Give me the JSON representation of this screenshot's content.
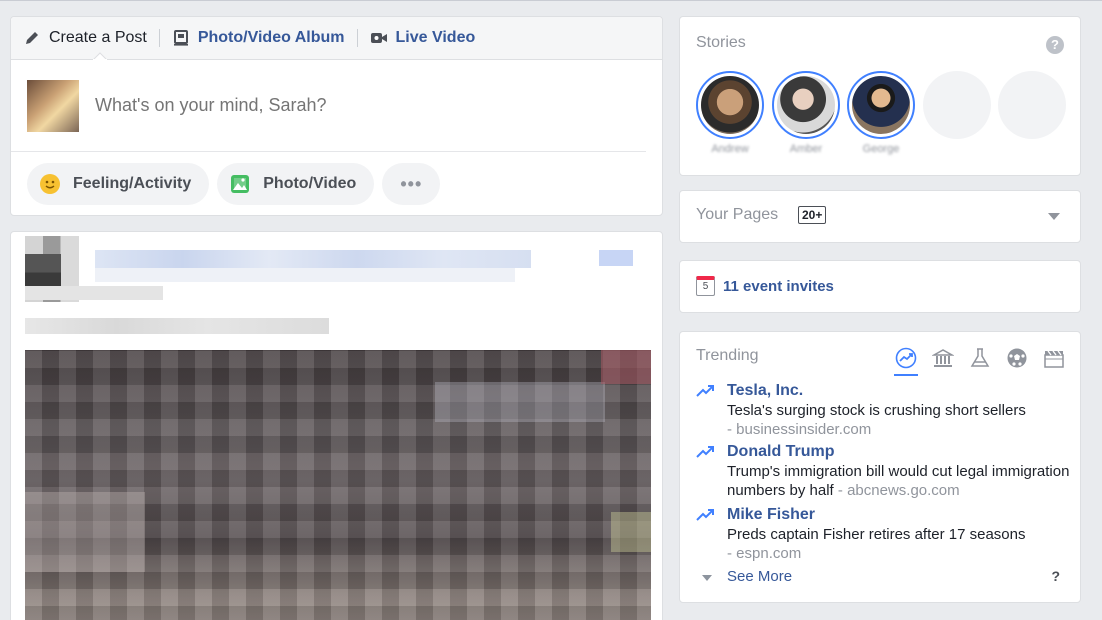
{
  "composer": {
    "tabs": [
      {
        "label": "Create a Post",
        "icon": "pencil-icon"
      },
      {
        "label": "Photo/Video Album",
        "icon": "album-icon"
      },
      {
        "label": "Live Video",
        "icon": "video-camera-icon"
      }
    ],
    "placeholder": "What's on your mind, Sarah?",
    "actions": [
      {
        "label": "Feeling/Activity",
        "icon": "smiley-icon"
      },
      {
        "label": "Photo/Video",
        "icon": "photo-icon"
      },
      {
        "label": "•••",
        "icon": "more-icon"
      }
    ]
  },
  "stories": {
    "title": "Stories",
    "help": "?",
    "people": [
      {
        "name": "Andrew"
      },
      {
        "name": "Amber"
      },
      {
        "name": "George"
      }
    ]
  },
  "pages": {
    "title": "Your Pages",
    "badge": "20+"
  },
  "events": {
    "day": "5",
    "label": "11 event invites"
  },
  "trending": {
    "title": "Trending",
    "categories": [
      "trending-icon",
      "politics-icon",
      "science-icon",
      "sports-icon",
      "entertainment-icon"
    ],
    "items": [
      {
        "topic": "Tesla, Inc.",
        "desc": "Tesla's surging stock is crushing short sellers",
        "source": "- businessinsider.com"
      },
      {
        "topic": "Donald Trump",
        "desc": "Trump's immigration bill would cut legal immigration numbers by half",
        "source": "- abcnews.go.com"
      },
      {
        "topic": "Mike Fisher",
        "desc": "Preds captain Fisher retires after 17 seasons",
        "source": "- espn.com"
      }
    ],
    "see_more": "See More",
    "help": "?"
  },
  "colors": {
    "link": "#365899",
    "accent": "#4080ff",
    "muted": "#90949c"
  }
}
